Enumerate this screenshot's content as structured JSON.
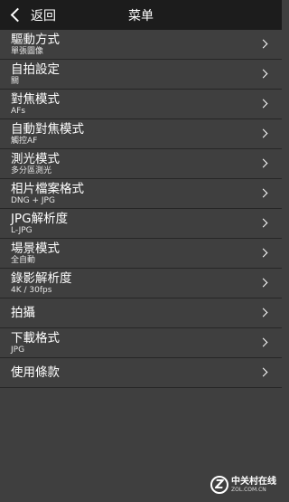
{
  "header": {
    "back_label": "返回",
    "title": "菜单"
  },
  "menu": [
    {
      "label": "驅動方式",
      "value": "單張圖像"
    },
    {
      "label": "自拍設定",
      "value": "關"
    },
    {
      "label": "對焦模式",
      "value": "AFs"
    },
    {
      "label": "自動對焦模式",
      "value": "觸控AF"
    },
    {
      "label": "測光模式",
      "value": "多分區測光"
    },
    {
      "label": "相片檔案格式",
      "value": "DNG + JPG"
    },
    {
      "label": "JPG解析度",
      "value": "L-JPG"
    },
    {
      "label": "場景模式",
      "value": "全自動"
    },
    {
      "label": "錄影解析度",
      "value": "4K / 30fps"
    },
    {
      "label": "拍攝",
      "value": null
    },
    {
      "label": "下載格式",
      "value": "JPG"
    },
    {
      "label": "使用條款",
      "value": null
    }
  ],
  "watermark": {
    "logo": "Z",
    "name": "中关村在线",
    "url": "ZOL.COM.CN"
  }
}
